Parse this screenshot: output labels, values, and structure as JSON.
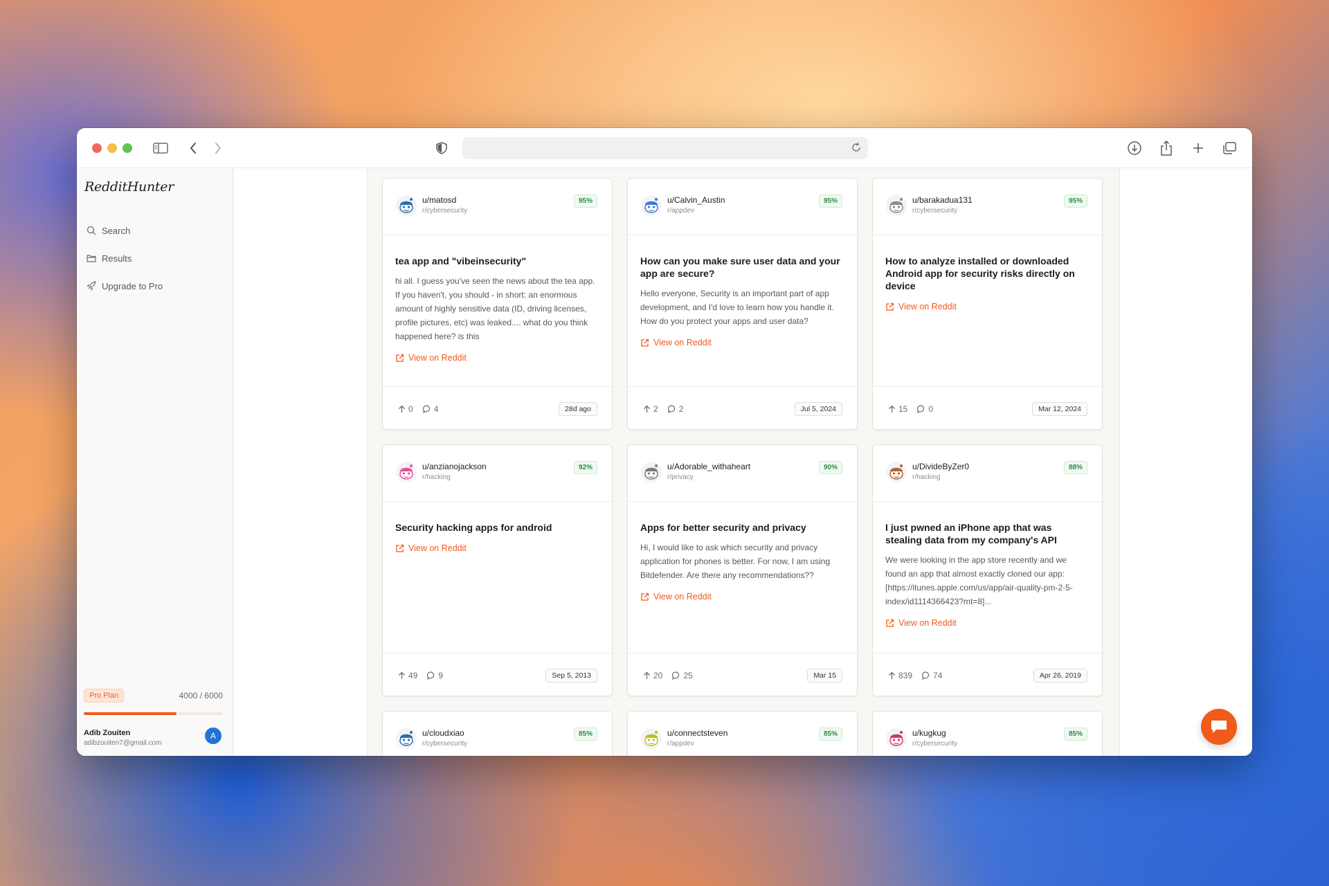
{
  "app": {
    "brand": "RedditHunter",
    "nav": [
      {
        "label": "Search",
        "icon": "search-icon"
      },
      {
        "label": "Results",
        "icon": "folder-icon"
      },
      {
        "label": "Upgrade to Pro",
        "icon": "rocket-icon"
      }
    ],
    "plan": {
      "badge": "Pro Plan",
      "count": "4000 / 6000",
      "used_fraction": 0.6667
    },
    "user": {
      "name": "Adib Zouiten",
      "email": "adibzouiten7@gmail.com",
      "avatar_letter": "A"
    }
  },
  "colors": {
    "accent": "#f05a1a",
    "score_green": "#2f8a48"
  },
  "cards": [
    {
      "user": "u/matosd",
      "sub": "r/cybersecurity",
      "score": "95%",
      "avatar_color": "#2a6fb0",
      "title": "tea app and \"vibeinsecurity\"",
      "text": "hi all. I guess you've seen the news about the tea app. If you haven't, you should - in short: an enormous amount of highly sensitive data (ID, driving licenses, profile pictures, etc) was leaked.... what do you think happened here? is this",
      "link": "View on Reddit",
      "upvotes": "0",
      "comments": "4",
      "date": "28d ago"
    },
    {
      "user": "u/Calvin_Austin",
      "sub": "r/appdev",
      "score": "95%",
      "avatar_color": "#3b7bd6",
      "title": "How can you make sure user data and your app are secure?",
      "text": "Hello everyone, Security is an important part of app development, and I'd love to learn how you handle it. How do you protect your apps and user data?",
      "link": "View on Reddit",
      "upvotes": "2",
      "comments": "2",
      "date": "Jul 5, 2024"
    },
    {
      "user": "u/barakadua131",
      "sub": "r/cybersecurity",
      "score": "95%",
      "avatar_color": "#8a8a8a",
      "title": "How to analyze installed or downloaded Android app for security risks directly on device",
      "text": "",
      "link": "View on Reddit",
      "upvotes": "15",
      "comments": "0",
      "date": "Mar 12, 2024"
    },
    {
      "user": "u/anzianojackson",
      "sub": "r/hacking",
      "score": "92%",
      "avatar_color": "#e0559a",
      "title": "Security hacking apps for android",
      "text": "",
      "link": "View on Reddit",
      "upvotes": "49",
      "comments": "9",
      "date": "Sep 5, 2013"
    },
    {
      "user": "u/Adorable_withaheart",
      "sub": "r/privacy",
      "score": "90%",
      "avatar_color": "#7a7a7a",
      "title": "Apps for better security and privacy",
      "text": "Hi, I would like to ask which security and privacy application for phones is better. For now, I am using Bitdefender. Are there any recommendations??",
      "link": "View on Reddit",
      "upvotes": "20",
      "comments": "25",
      "date": "Mar 15"
    },
    {
      "user": "u/DivideByZer0",
      "sub": "r/hacking",
      "score": "88%",
      "avatar_color": "#b0653a",
      "title": "I just pwned an iPhone app that was stealing data from my company's API",
      "text": "We were looking in the app store recently and we found an app that almost exactly cloned our app: [https://itunes.apple.com/us/app/air-quality-pm-2-5-index/id1114366423?mt=8]...",
      "link": "View on Reddit",
      "upvotes": "839",
      "comments": "74",
      "date": "Apr 26, 2019"
    },
    {
      "user": "u/cloudxiao",
      "sub": "r/cybersecurity",
      "score": "85%",
      "avatar_color": "#2a6fb0"
    },
    {
      "user": "u/connectsteven",
      "sub": "r/appdev",
      "score": "85%",
      "avatar_color": "#b8c21a"
    },
    {
      "user": "u/kugkug",
      "sub": "r/cybersecurity",
      "score": "85%",
      "avatar_color": "#d6336c"
    }
  ]
}
